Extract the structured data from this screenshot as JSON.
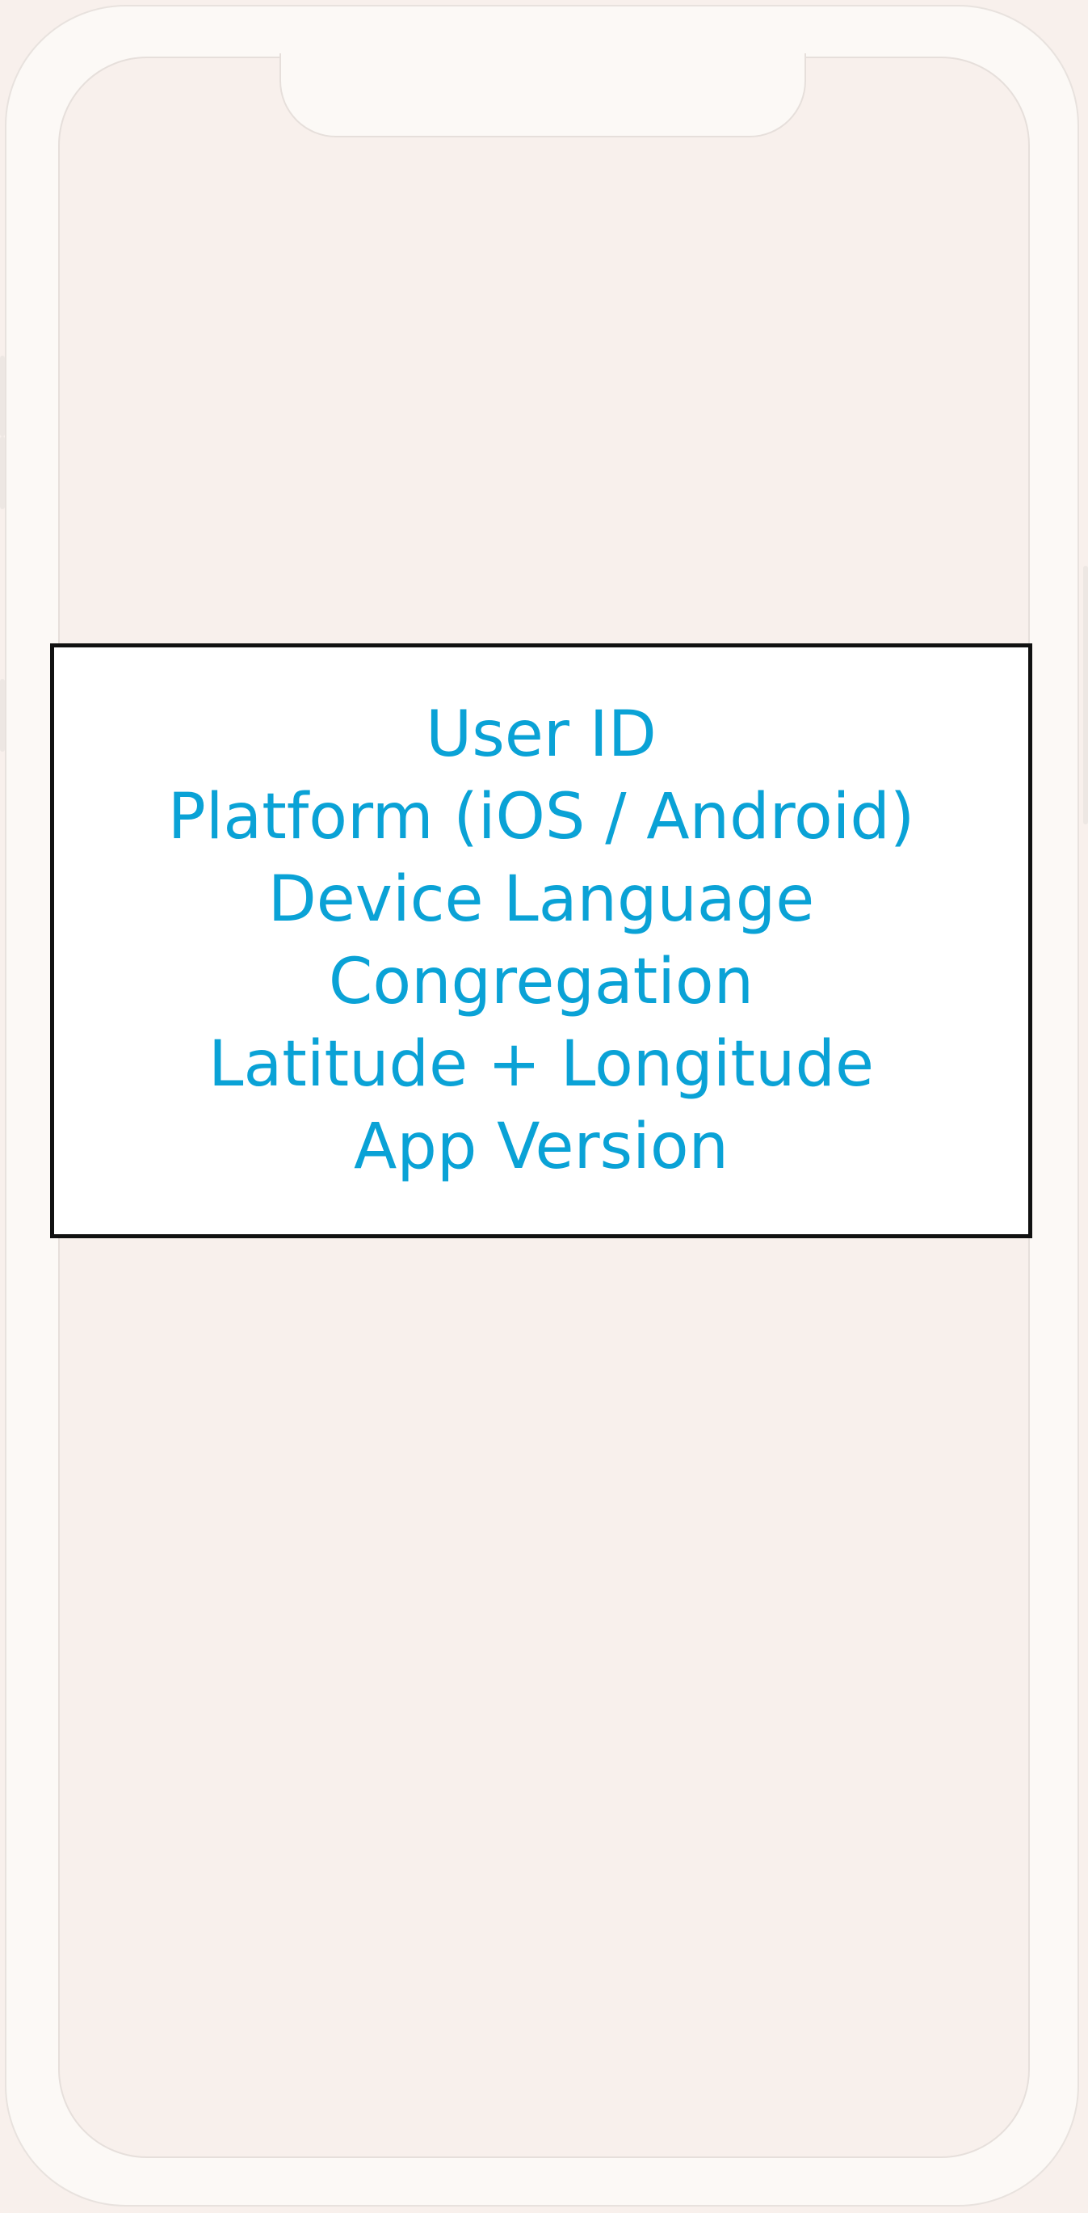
{
  "device": {
    "frame_color": "#fcf9f6",
    "screen_color": "#f8f0ec"
  },
  "info_box": {
    "text_color": "#0aa2d6",
    "border_color": "#111111",
    "lines": [
      "User ID",
      "Platform (iOS / Android)",
      "Device Language",
      "Congregation",
      "Latitude + Longitude",
      "App Version"
    ]
  }
}
